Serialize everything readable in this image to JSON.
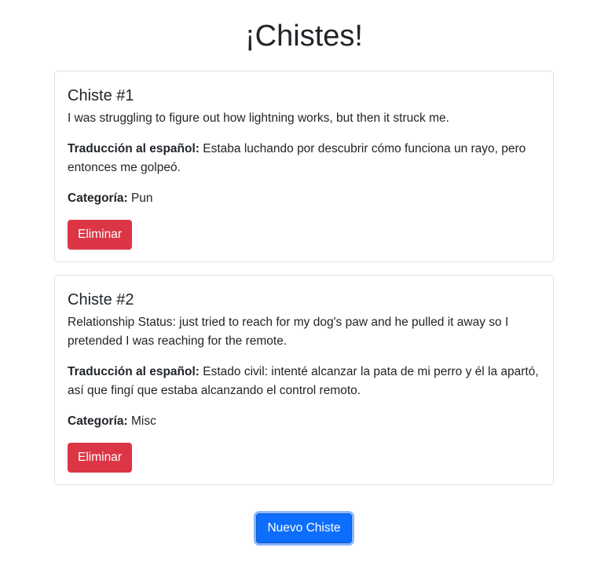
{
  "page": {
    "title": "¡Chistes!"
  },
  "labels": {
    "translation": "Traducción al español:",
    "category": "Categoría:"
  },
  "jokes": [
    {
      "title": "Chiste #1",
      "text": "I was struggling to figure out how lightning works, but then it struck me.",
      "translation": "Estaba luchando por descubrir cómo funciona un rayo, pero entonces me golpeó.",
      "category": "Pun",
      "delete_label": "Eliminar"
    },
    {
      "title": "Chiste #2",
      "text": "Relationship Status: just tried to reach for my dog's paw and he pulled it away so I pretended I was reaching for the remote.",
      "translation": "Estado civil: intenté alcanzar la pata de mi perro y él la apartó, así que fingí que estaba alcanzando el control remoto.",
      "category": "Misc",
      "delete_label": "Eliminar"
    }
  ],
  "actions": {
    "new_joke_label": "Nuevo Chiste"
  },
  "colors": {
    "danger": "#dc3545",
    "primary": "#0d6efd",
    "text": "#212529",
    "card_border": "#dfe2e6"
  }
}
